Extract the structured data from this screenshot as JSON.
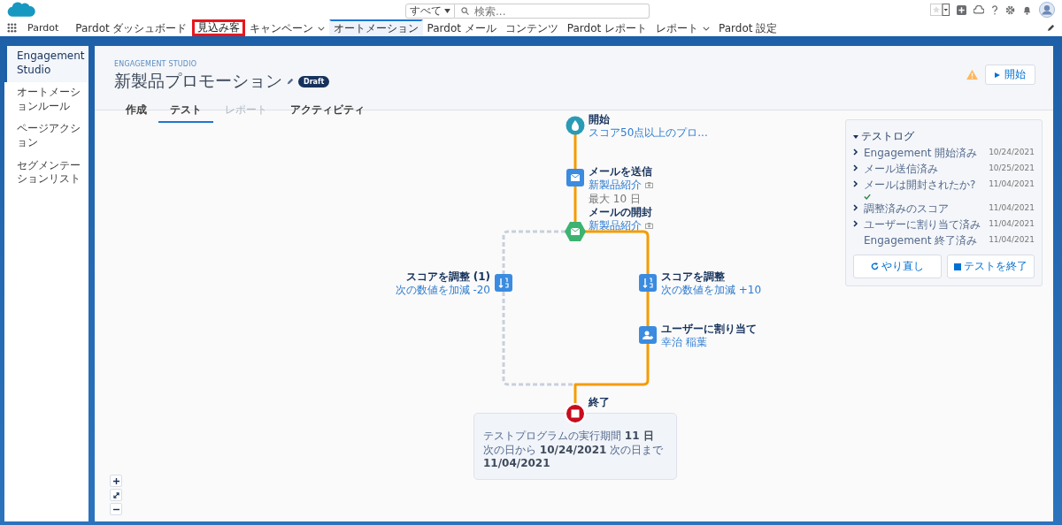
{
  "header": {
    "search": {
      "scope": "すべて",
      "placeholder": "検索..."
    }
  },
  "nav": {
    "app_name": "Pardot",
    "items": [
      {
        "label": "Pardot ダッシュボード",
        "selected": false,
        "highlighted": false,
        "has_menu": false
      },
      {
        "label": "見込み客",
        "selected": false,
        "highlighted": true,
        "has_menu": false
      },
      {
        "label": "キャンペーン",
        "selected": false,
        "highlighted": false,
        "has_menu": true
      },
      {
        "label": "オートメーション",
        "selected": true,
        "highlighted": false,
        "has_menu": false
      },
      {
        "label": "Pardot メール",
        "selected": false,
        "highlighted": false,
        "has_menu": false
      },
      {
        "label": "コンテンツ",
        "selected": false,
        "highlighted": false,
        "has_menu": false
      },
      {
        "label": "Pardot レポート",
        "selected": false,
        "highlighted": false,
        "has_menu": false
      },
      {
        "label": "レポート",
        "selected": false,
        "highlighted": false,
        "has_menu": true
      },
      {
        "label": "Pardot 設定",
        "selected": false,
        "highlighted": false,
        "has_menu": false
      }
    ]
  },
  "sidebar": {
    "items": [
      {
        "label": "Engagement Studio",
        "selected": true
      },
      {
        "label": "オートメーションルール",
        "selected": false
      },
      {
        "label": "ページアクション",
        "selected": false
      },
      {
        "label": "セグメンテーションリスト",
        "selected": false
      }
    ]
  },
  "program": {
    "eyebrow": "ENGAGEMENT STUDIO",
    "title": "新製品プロモーション",
    "status": "Draft",
    "start_button": "開始",
    "tabs": [
      {
        "label": "作成",
        "selected": false,
        "disabled": false
      },
      {
        "label": "テスト",
        "selected": true,
        "disabled": false
      },
      {
        "label": "レポート",
        "selected": false,
        "disabled": true
      },
      {
        "label": "アクティビティ",
        "selected": false,
        "disabled": false
      }
    ]
  },
  "flow": {
    "nodes": [
      {
        "kind": "start",
        "title": "開始",
        "subtitle": "スコア50点以上のプロ..."
      },
      {
        "kind": "action",
        "title": "メールを送信",
        "subtitle": "新製品紹介",
        "has_preview": true
      },
      {
        "kind": "trigger",
        "pre": "最大 10 日",
        "title": "メールの開封",
        "subtitle": "新製品紹介",
        "has_preview": true
      },
      {
        "kind": "action",
        "title": "スコアを調整 (1)",
        "subtitle": "次の数値を加減 -20",
        "has_preview": false
      },
      {
        "kind": "action",
        "title": "スコアを調整",
        "subtitle": "次の数値を加減 +10",
        "has_preview": false
      },
      {
        "kind": "action",
        "title": "ユーザーに割り当て",
        "subtitle": "幸治 稲葉",
        "has_preview": false
      },
      {
        "kind": "end",
        "title": "終了"
      }
    ],
    "summary": [
      "テストプログラムの実行期間 **11 日**",
      "次の日から **10/24/2021** 次の日まで",
      "**11/04/2021**"
    ]
  },
  "test_log": {
    "title": "テストログ",
    "expanded": true,
    "entries": [
      {
        "label": "Engagement 開始済み",
        "date": "10/24/2021",
        "expandable": true,
        "passed": false
      },
      {
        "label": "メール送信済み",
        "date": "10/25/2021",
        "expandable": true,
        "passed": false
      },
      {
        "label": "メールは開封されたか?",
        "date": "11/04/2021",
        "expandable": true,
        "passed": true
      },
      {
        "label": "調整済みのスコア",
        "date": "11/04/2021",
        "expandable": true,
        "passed": false
      },
      {
        "label": "ユーザーに割り当て済み",
        "date": "11/04/2021",
        "expandable": true,
        "passed": false
      },
      {
        "label": "Engagement 終了済み",
        "date": "11/04/2021",
        "expandable": false,
        "passed": false
      }
    ],
    "buttons": [
      {
        "kind": "restart",
        "label": "やり直し"
      },
      {
        "kind": "stop",
        "label": "テストを終了"
      }
    ]
  }
}
